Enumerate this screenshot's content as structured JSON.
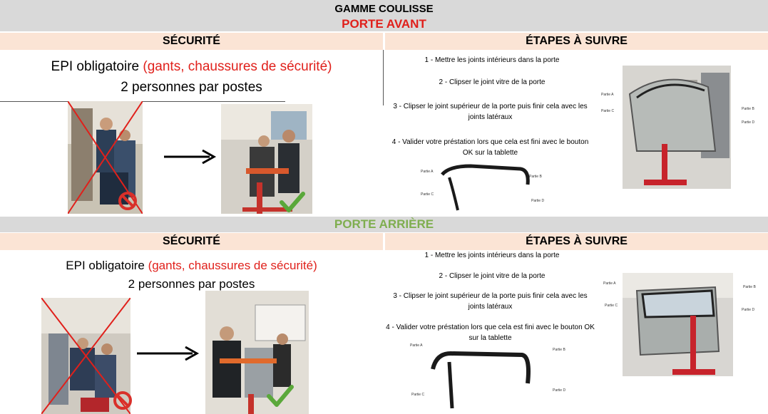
{
  "header": {
    "title": "GAMME COULISSE"
  },
  "front": {
    "title": "PORTE AVANT",
    "security": {
      "heading": "SÉCURITÉ",
      "epi_prefix": "EPI obligatoire ",
      "epi_highlight": "(gants, chaussures de sécurité)",
      "persons": "2 personnes par postes"
    },
    "steps": {
      "heading": "ÉTAPES À SUIVRE",
      "items": [
        "1 - Mettre les joints intérieurs dans la porte",
        "2 - Clipser le joint vitre de la porte",
        "3 - Clipser le joint supérieur de la porte puis finir cela avec les joints latéraux",
        "4 - Valider votre préstation lors que cela est fini avec le bouton OK sur la tablette"
      ]
    },
    "labels": {
      "part_a": "Partie A",
      "part_b": "Partie B",
      "part_c": "Partie C",
      "part_d": "Partie D"
    }
  },
  "rear": {
    "title": "PORTE ARRIÈRE",
    "security": {
      "heading": "SÉCURITÉ",
      "epi_prefix": "EPI obligatoire ",
      "epi_highlight": "(gants, chaussures de sécurité)",
      "persons": "2 personnes par postes"
    },
    "steps": {
      "heading": "ÉTAPES À SUIVRE",
      "items": [
        "1 -  Mettre les joints intérieurs dans la porte",
        "2 - Clipser le joint vitre de la porte",
        "3 - Clipser le joint supérieur de la porte puis finir cela avec les joints latéraux",
        "4 - Valider votre préstation lors que cela est fini avec le bouton OK sur la tablette"
      ]
    },
    "labels": {
      "part_a": "Partie A",
      "part_b": "Partie B",
      "part_c": "Partie C",
      "part_d": "Partie D"
    }
  },
  "icons": {
    "forbidden": "prohibited-sign-icon",
    "allowed": "check-mark-icon",
    "arrow": "arrow-right-icon"
  },
  "colors": {
    "band_gray": "#d9d9d9",
    "security_band": "#fbe4d5",
    "front_title": "#e0201b",
    "rear_title": "#7fae4f",
    "check_green": "#5aa83a",
    "forbidden_red": "#d9302a"
  }
}
